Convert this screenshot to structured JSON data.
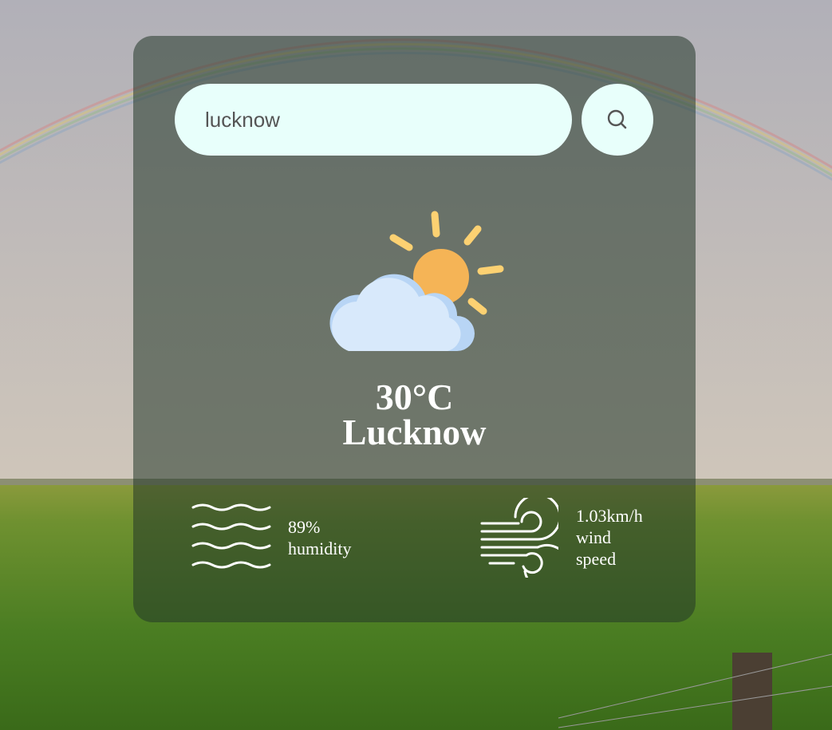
{
  "search": {
    "value": "lucknow",
    "icon": "search-icon"
  },
  "weather": {
    "icon": "partly-cloudy-icon",
    "temperature": "30°C",
    "city": "Lucknow"
  },
  "humidity": {
    "icon": "humidity-waves-icon",
    "value": "89%",
    "label": "humidity"
  },
  "wind": {
    "icon": "wind-icon",
    "value": "1.03km/h",
    "label_line1": "wind",
    "label_line2": "speed"
  },
  "colors": {
    "input_bg": "#e8fffb",
    "sun": "#f5b456",
    "sun_rays": "#fcd172",
    "cloud": "#d8e9fb",
    "cloud_shadow": "#b8d5f5",
    "text": "#ffffff"
  }
}
